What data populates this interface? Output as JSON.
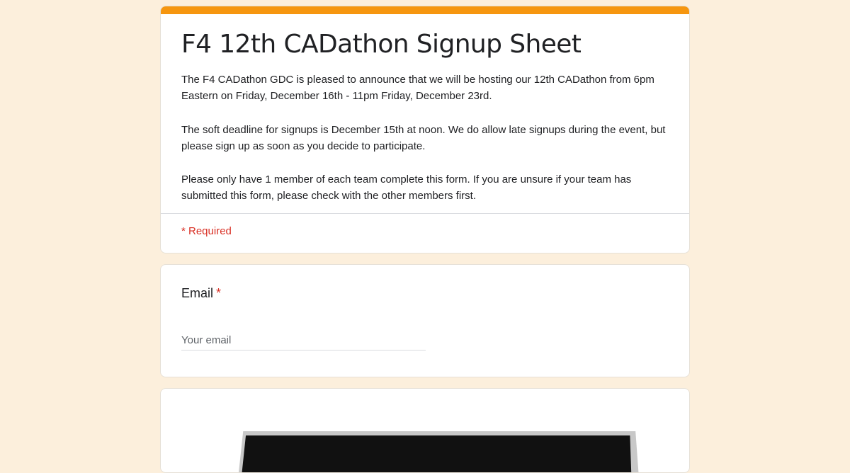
{
  "form": {
    "title": "F4 12th CADathon Signup Sheet",
    "description": [
      "The F4 CADathon GDC is pleased to announce that we will be hosting our 12th CADathon from 6pm Eastern on Friday, December 16th - 11pm Friday, December 23rd.",
      "The soft deadline for signups is December 15th at noon. We do allow late signups during the event, but please sign up as soon as you decide to participate.",
      "Please only have 1 member of each team complete this form. If you are unsure if your team has submitted this form, please check with the other members first."
    ],
    "required_note": "* Required"
  },
  "questions": {
    "email": {
      "label": "Email",
      "required_marker": "*",
      "placeholder": "Your email",
      "value": ""
    }
  },
  "media": {
    "image_icon": "laptop-image"
  },
  "colors": {
    "background": "#fcefdc",
    "accent": "#f6960f",
    "required": "#d93025"
  }
}
